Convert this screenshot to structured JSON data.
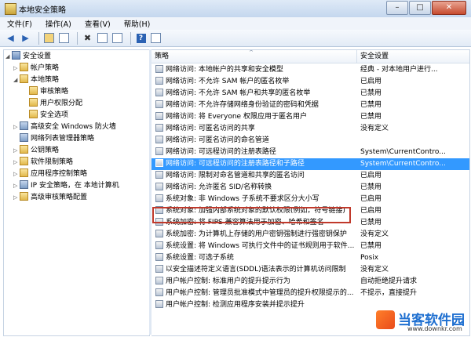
{
  "window": {
    "title": "本地安全策略",
    "controls": {
      "minimize": "–",
      "maximize": "□",
      "close": "✕"
    }
  },
  "menu": [
    {
      "label": "文件(F)"
    },
    {
      "label": "操作(A)"
    },
    {
      "label": "查看(V)"
    },
    {
      "label": "帮助(H)"
    }
  ],
  "toolbar": {
    "back_glyph": "◀",
    "forward_glyph": "▶",
    "delete_glyph": "✖",
    "help_glyph": "?"
  },
  "tree": [
    {
      "label": "安全设置",
      "expand": "◢",
      "icon": "root",
      "level": 0
    },
    {
      "label": "帐户策略",
      "expand": "▷",
      "icon": "folder",
      "level": 1
    },
    {
      "label": "本地策略",
      "expand": "◢",
      "icon": "folder",
      "level": 1
    },
    {
      "label": "审核策略",
      "expand": "",
      "icon": "folder",
      "level": 2
    },
    {
      "label": "用户权限分配",
      "expand": "",
      "icon": "folder",
      "level": 2
    },
    {
      "label": "安全选项",
      "expand": "",
      "icon": "folder",
      "level": 2
    },
    {
      "label": "高级安全 Windows 防火墙",
      "expand": "▷",
      "icon": "book",
      "level": 1
    },
    {
      "label": "网络列表管理器策略",
      "expand": "",
      "icon": "book",
      "level": 1
    },
    {
      "label": "公钥策略",
      "expand": "▷",
      "icon": "folder",
      "level": 1
    },
    {
      "label": "软件限制策略",
      "expand": "▷",
      "icon": "folder",
      "level": 1
    },
    {
      "label": "应用程序控制策略",
      "expand": "▷",
      "icon": "folder",
      "level": 1
    },
    {
      "label": "IP 安全策略，在 本地计算机",
      "expand": "▷",
      "icon": "book",
      "level": 1
    },
    {
      "label": "高级审核策略配置",
      "expand": "▷",
      "icon": "folder",
      "level": 1
    }
  ],
  "list": {
    "columns": {
      "policy": "策略",
      "setting": "安全设置",
      "sort_glyph": "^"
    },
    "rows": [
      {
        "policy": "网络访问: 本地帐户的共享和安全模型",
        "setting": "经典 - 对本地用户进行..."
      },
      {
        "policy": "网络访问: 不允许 SAM 帐户的匿名枚举",
        "setting": "已启用"
      },
      {
        "policy": "网络访问: 不允许 SAM 帐户和共享的匿名枚举",
        "setting": "已禁用"
      },
      {
        "policy": "网络访问: 不允许存储网络身份验证的密码和凭据",
        "setting": "已禁用"
      },
      {
        "policy": "网络访问: 将 Everyone 权限应用于匿名用户",
        "setting": "已禁用"
      },
      {
        "policy": "网络访问: 可匿名访问的共享",
        "setting": "没有定义"
      },
      {
        "policy": "网络访问: 可匿名访问的命名管道",
        "setting": ""
      },
      {
        "policy": "网络访问: 可远程访问的注册表路径",
        "setting": "System\\CurrentContro..."
      },
      {
        "policy": "网络访问: 可远程访问的注册表路径和子路径",
        "setting": "System\\CurrentContro...",
        "selected": true
      },
      {
        "policy": "网络访问: 限制对命名管道和共享的匿名访问",
        "setting": "已启用"
      },
      {
        "policy": "网络访问: 允许匿名 SID/名称转换",
        "setting": "已禁用"
      },
      {
        "policy": "系统对象: 非 Windows 子系统不要求区分大小写",
        "setting": "已启用"
      },
      {
        "policy": "系统对象: 加强内部系统对象的默认权限(例如，符号链接)",
        "setting": "已启用"
      },
      {
        "policy": "系统加密: 将 FIPS 兼容算法用于加密、哈希和签名",
        "setting": "已禁用"
      },
      {
        "policy": "系统加密: 为计算机上存储的用户密钥强制进行强密钥保护",
        "setting": "没有定义"
      },
      {
        "policy": "系统设置: 将 Windows 可执行文件中的证书规则用于软件...",
        "setting": "已禁用"
      },
      {
        "policy": "系统设置: 可选子系统",
        "setting": "Posix"
      },
      {
        "policy": "以安全描述符定义语言(SDDL)语法表示的计算机访问限制",
        "setting": "没有定义"
      },
      {
        "policy": "用户帐户控制: 标准用户的提升提示行为",
        "setting": "自动拒绝提升请求"
      },
      {
        "policy": "用户帐户控制: 管理员批准模式中管理员的提升权限提示的...",
        "setting": "不提示，直接提升"
      },
      {
        "policy": "用户帐户控制: 检测应用程序安装并提示提升",
        "setting": ""
      }
    ]
  },
  "watermark": {
    "text": "当客软件园",
    "url": "www.downkr.com"
  },
  "colors": {
    "selection": "#3399ff",
    "highlight_border": "#c0392b",
    "watermark_text": "#1e6fd0"
  }
}
